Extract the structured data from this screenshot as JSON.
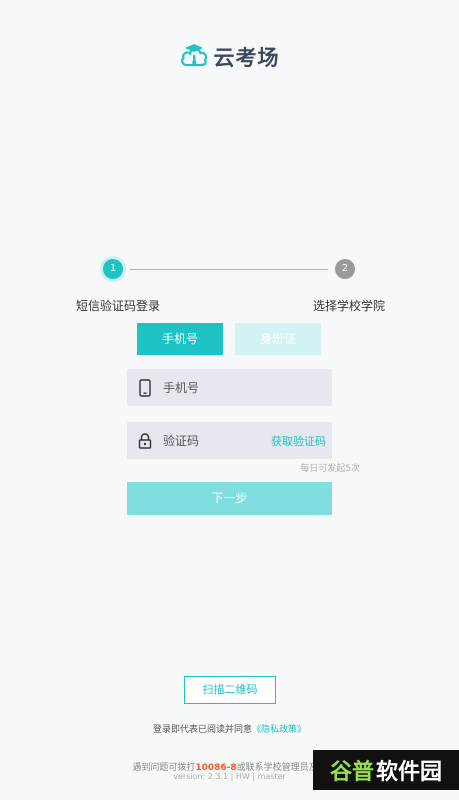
{
  "app": {
    "name": "云考场"
  },
  "stepper": {
    "steps": [
      {
        "number": "1",
        "label": "短信验证码登录"
      },
      {
        "number": "2",
        "label": "选择学校学院"
      }
    ]
  },
  "tabs": [
    {
      "label": "手机号",
      "active": true
    },
    {
      "label": "身份证",
      "active": false
    }
  ],
  "form": {
    "phone_placeholder": "手机号",
    "code_placeholder": "验证码",
    "get_code_label": "获取验证码",
    "limit_hint": "每日可发起5次",
    "next_label": "下一步"
  },
  "scan_label": "扫描二维码",
  "agreement": {
    "prefix": "登录即代表已阅读并同意",
    "policy_label": "《隐私政策》"
  },
  "footer": {
    "help_prefix": "遇到问题可拨打",
    "help_phone": "10086-8",
    "help_suffix": "或联系学校管理员及时",
    "version": "version: 2.3.1 | HW | master"
  },
  "watermark": {
    "part1": "谷普",
    "part2": "软件园"
  },
  "colors": {
    "accent": "#1dc3c5",
    "accent_light": "#80dede",
    "tab_inactive": "#d3f2f2",
    "highlight": "#f05a28"
  }
}
